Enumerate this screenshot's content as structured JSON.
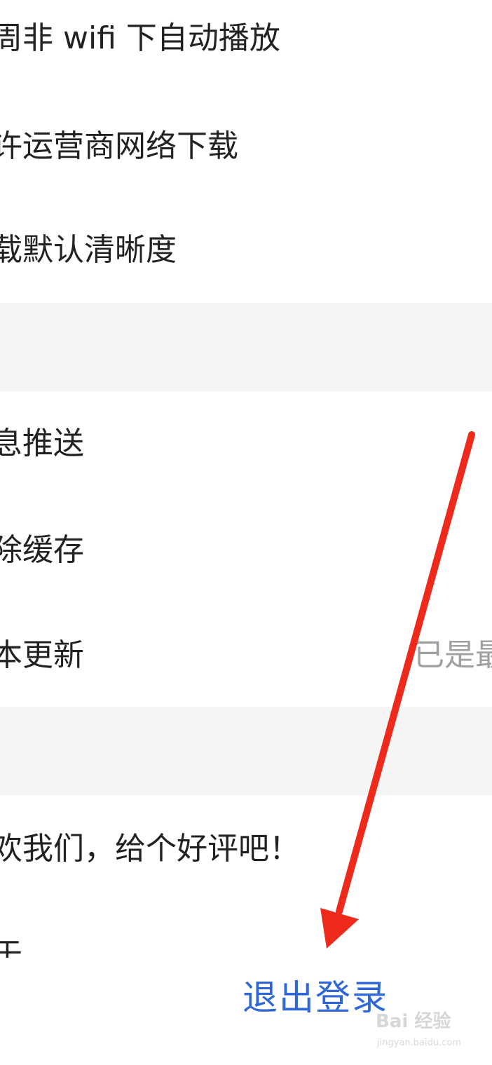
{
  "settings": {
    "group1": [
      {
        "label": "周非 wifi 下自动播放"
      },
      {
        "label": "许运营商网络下载"
      },
      {
        "label": "载默认清晰度"
      }
    ],
    "group2": [
      {
        "label": "息推送"
      },
      {
        "label": "除缓存"
      },
      {
        "label": "本更新",
        "value": "已是最"
      }
    ],
    "group3": [
      {
        "label": "欢我们，给个好评吧！"
      },
      {
        "label": "于"
      }
    ]
  },
  "logout": {
    "label": "退出登录",
    "color": "#2f67d6"
  },
  "annotation": {
    "arrow_color": "#ee2a1c",
    "icon": "red-arrow-icon"
  },
  "watermark": {
    "logo": "Bai 经验",
    "url": "jingyan.baidu.com"
  }
}
